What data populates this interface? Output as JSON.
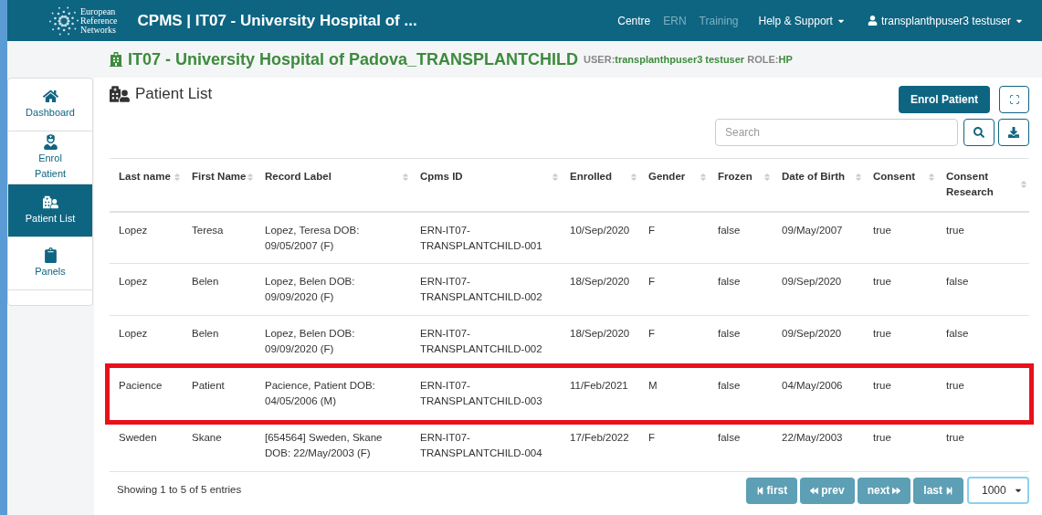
{
  "header": {
    "logo_text": [
      "European",
      "Reference",
      "Networks"
    ],
    "title": "CPMS | IT07 - University Hospital of ...",
    "nav": [
      {
        "label": "Centre",
        "disabled": false
      },
      {
        "label": "ERN",
        "disabled": true
      },
      {
        "label": "Training",
        "disabled": true
      }
    ],
    "help": "Help & Support",
    "user": "transplanthpuser3 testuser"
  },
  "subheader": {
    "title": "IT07 - University Hospital of Padova_TRANSPLANTCHILD",
    "user_label": "USER:",
    "user": "transplanthpuser3 testuser",
    "role_label": "ROLE:",
    "role": "HP"
  },
  "sidebar": [
    {
      "label": "Dashboard",
      "kind": "home",
      "selected": false
    },
    {
      "label": "Enrol Patient",
      "kind": "enrol",
      "selected": false
    },
    {
      "label": "Patient List",
      "kind": "list",
      "selected": true
    },
    {
      "label": "Panels",
      "kind": "panels",
      "selected": false
    }
  ],
  "page_title": "Patient List",
  "enrol_button": "Enrol Patient",
  "search": {
    "placeholder": "Search"
  },
  "table": {
    "columns": [
      "Last name",
      "First Name",
      "Record Label",
      "Cpms ID",
      "Enrolled",
      "Gender",
      "Frozen",
      "Date of Birth",
      "Consent",
      "Consent Research"
    ],
    "rows": [
      {
        "highlighted": false,
        "cells": [
          "Lopez",
          "Teresa",
          "Lopez, Teresa DOB: 09/05/2007 (F)",
          "ERN-IT07-TRANSPLANTCHILD-001",
          "10/Sep/2020",
          "F",
          "false",
          "09/May/2007",
          "true",
          "true"
        ]
      },
      {
        "highlighted": false,
        "cells": [
          "Lopez",
          "Belen",
          "Lopez, Belen DOB: 09/09/2020 (F)",
          "ERN-IT07-TRANSPLANTCHILD-002",
          "18/Sep/2020",
          "F",
          "false",
          "09/Sep/2020",
          "true",
          "false"
        ]
      },
      {
        "highlighted": false,
        "cells": [
          "Lopez",
          "Belen",
          "Lopez, Belen DOB: 09/09/2020 (F)",
          "ERN-IT07-TRANSPLANTCHILD-002",
          "18/Sep/2020",
          "F",
          "false",
          "09/Sep/2020",
          "true",
          "false"
        ]
      },
      {
        "highlighted": true,
        "cells": [
          "Pacience",
          "Patient",
          "Pacience, Patient DOB: 04/05/2006 (M)",
          "ERN-IT07-TRANSPLANTCHILD-003",
          "11/Feb/2021",
          "M",
          "false",
          "04/May/2006",
          "true",
          "true"
        ]
      },
      {
        "highlighted": false,
        "cells": [
          "Sweden",
          "Skane",
          "[654564] Sweden, Skane DOB: 22/May/2003 (F)",
          "ERN-IT07-TRANSPLANTCHILD-004",
          "17/Feb/2022",
          "F",
          "false",
          "22/May/2003",
          "true",
          "true"
        ]
      }
    ]
  },
  "footer": {
    "info": "Showing 1 to 5 of 5 entries",
    "pager": [
      {
        "label": "first",
        "kind": "first"
      },
      {
        "label": "prev",
        "kind": "prev"
      },
      {
        "label": "next",
        "kind": "next"
      },
      {
        "label": "last",
        "kind": "last"
      }
    ],
    "page_size": "1000"
  }
}
